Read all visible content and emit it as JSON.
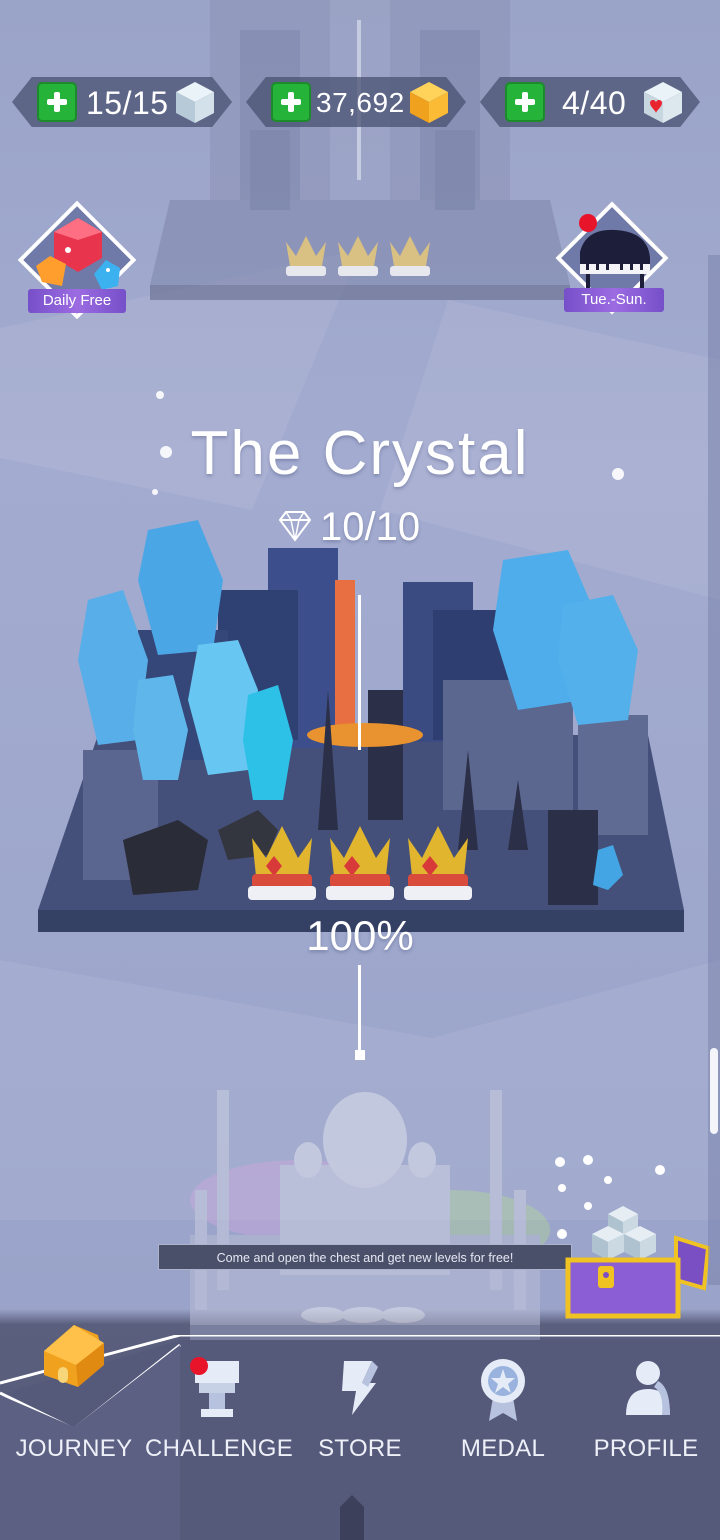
{
  "resources": [
    {
      "name": "energy",
      "value": "15/15",
      "icon": "light-blue-cube-icon"
    },
    {
      "name": "coins",
      "value": "37,692",
      "icon": "gold-cube-icon"
    },
    {
      "name": "hearts",
      "value": "4/40",
      "icon": "heart-cube-icon"
    }
  ],
  "badges": {
    "left_label": "Daily Free",
    "right_label": "Tue.-Sun."
  },
  "level": {
    "title": "The Crystal",
    "gems": "10/10",
    "progress": "100%",
    "crowns_earned": 3,
    "crowns_total": 3
  },
  "tooltip": "Come and open the chest and get new levels for free!",
  "nav": {
    "items": [
      {
        "label": "JOURNEY",
        "icon": "house-icon",
        "active": true
      },
      {
        "label": "CHALLENGE",
        "icon": "trophy-icon",
        "has_dot": true
      },
      {
        "label": "STORE",
        "icon": "store-icon"
      },
      {
        "label": "MEDAL",
        "icon": "medal-icon"
      },
      {
        "label": "PROFILE",
        "icon": "profile-icon"
      }
    ]
  },
  "colors": {
    "background": "#9ea7cc",
    "nav_bg": "#55597a",
    "plus_green": "#25b33a",
    "badge_purple": "#8a5fd8",
    "notification_red": "#e8152a"
  }
}
